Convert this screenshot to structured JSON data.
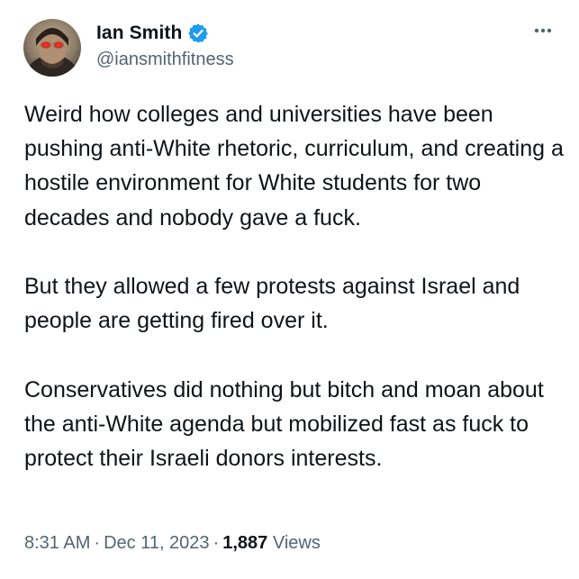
{
  "author": {
    "display_name": "Ian Smith",
    "handle": "@iansmithfitness",
    "verified": true,
    "verified_color": "#1d9bf0"
  },
  "menu": {
    "icon": "more-horizontal-icon"
  },
  "tweet": {
    "paragraphs": [
      "Weird how colleges and universities have been pushing anti-White rhetoric, curriculum, and creating a hostile environment for White students for two decades and nobody gave a fuck.",
      "But they allowed a few protests against Israel and people are getting fired over it.",
      "Conservatives did nothing but bitch and moan about the anti-White agenda but mobilized fast as fuck to protect their Israeli donors interests."
    ]
  },
  "meta": {
    "time": "8:31 AM",
    "date": "Dec 11, 2023",
    "separator": "·",
    "views_count": "1,887",
    "views_label": "Views"
  },
  "colors": {
    "text_primary": "#0f1419",
    "text_secondary": "#536471",
    "accent": "#1d9bf0"
  }
}
